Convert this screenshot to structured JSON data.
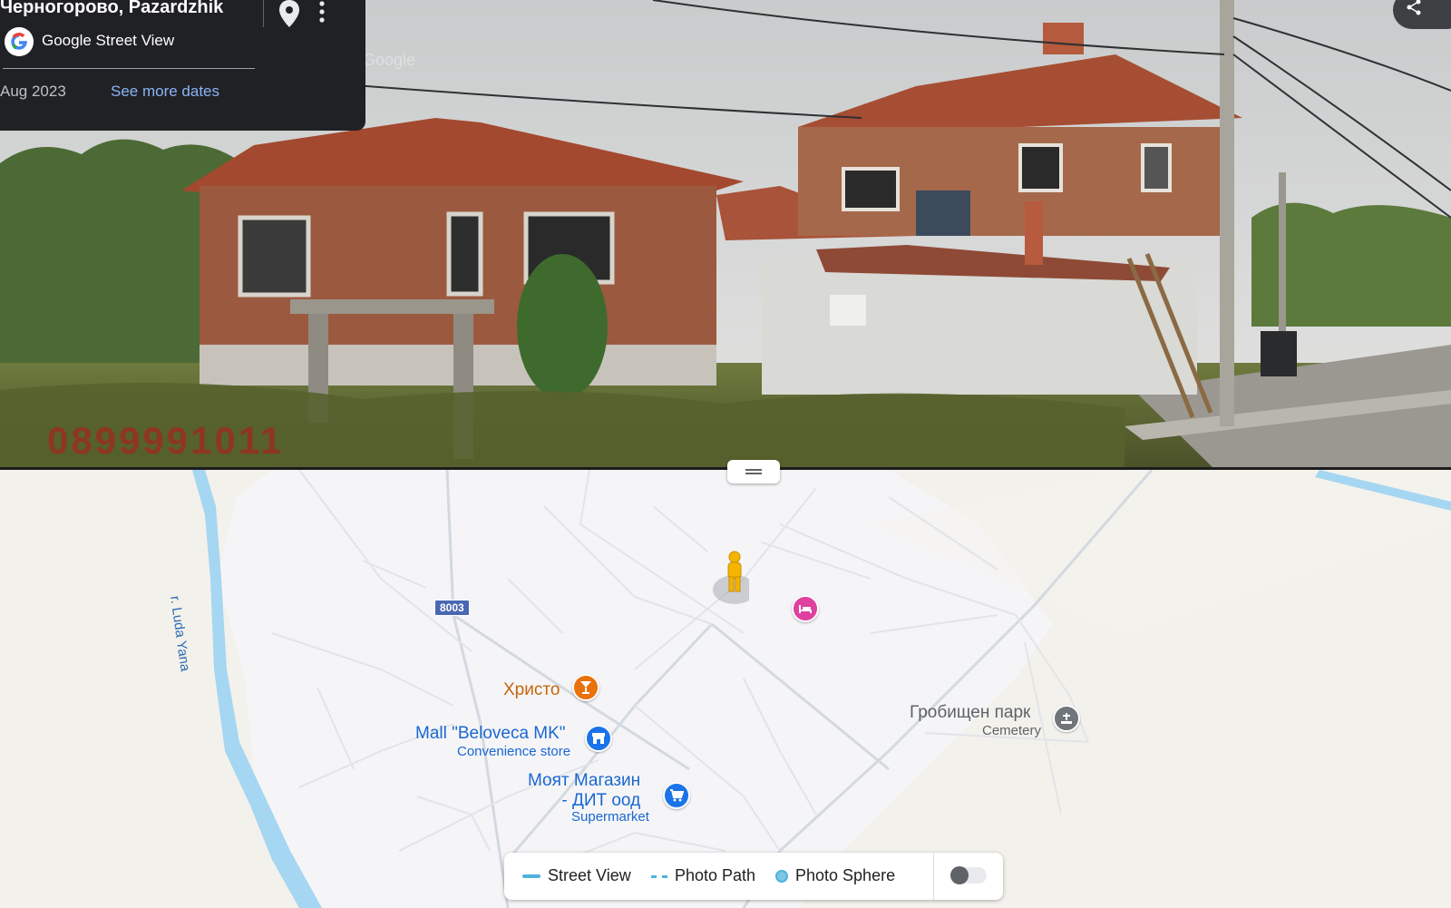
{
  "header": {
    "place_title": "Черногорово, Pazardzhik",
    "source_label": "Google Street View",
    "capture_date": "Aug 2023",
    "see_more_dates": "See more dates"
  },
  "panorama": {
    "overlay_watermark": "0899991011",
    "google_watermark": "Google"
  },
  "map": {
    "route_number": "8003",
    "river_label": "r. Luda Yana",
    "pois": [
      {
        "name": "Христо",
        "category": "",
        "icon": "bar-icon",
        "color": "#e8710a"
      },
      {
        "name": "Mall \"Beloveca MK\"",
        "category": "Convenience store",
        "icon": "store-icon",
        "color": "#1a73e8"
      },
      {
        "name": "Моят Магазин\n- ДИТ оод",
        "category": "Supermarket",
        "icon": "cart-icon",
        "color": "#1a73e8"
      },
      {
        "name": "Гробищен парк",
        "category": "Cemetery",
        "icon": "cemetery-icon",
        "color": "#70757a"
      },
      {
        "name": "",
        "category": "",
        "icon": "lodging-icon",
        "color": "#e040a0"
      }
    ]
  },
  "legend": {
    "street_view": "Street View",
    "photo_path": "Photo Path",
    "photo_sphere": "Photo Sphere"
  },
  "colors": {
    "accent_blue": "#8ab4f8",
    "card_bg": "#202124",
    "coverage_line": "#4fb3d9"
  }
}
